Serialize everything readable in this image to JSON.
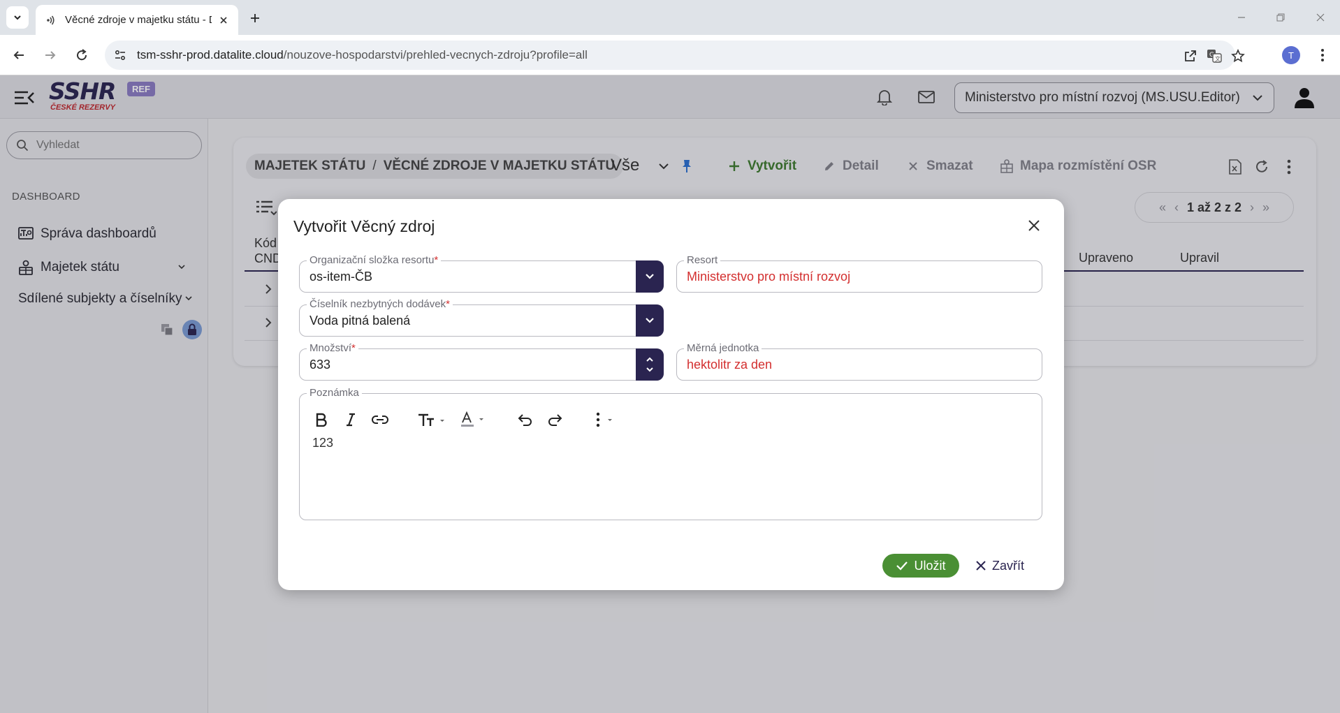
{
  "browser": {
    "tab_title": "Věcné zdroje v majetku státu - DataLite",
    "url_host": "tsm-sshr-prod.datalite.cloud",
    "url_path": "/nouzove-hospodarstvi/prehled-vecnych-zdroju?profile=all",
    "profile_initial": "T"
  },
  "header": {
    "logo_text": "SSHR",
    "logo_sub": "ČESKÉ REZERVY",
    "env_badge": "REF",
    "organization": "Ministerstvo pro místní rozvoj (MS.USU.Editor)"
  },
  "sidebar": {
    "search_placeholder": "Vyhledat",
    "section": "DASHBOARD",
    "items": [
      {
        "label": "Správa dashboardů",
        "icon": "dashboard-icon"
      },
      {
        "label": "Majetek státu",
        "icon": "property-icon"
      },
      {
        "label": "Sdílené subjekty a číselníky",
        "icon": ""
      }
    ]
  },
  "main": {
    "breadcrumb": [
      "MAJETEK STÁTU",
      "VĚCNÉ ZDROJE V MAJETKU STÁTU"
    ],
    "profile": "Vše",
    "toolbar": {
      "create": "Vytvořit",
      "detail": "Detail",
      "delete": "Smazat",
      "map": "Mapa rozmístění OSR"
    },
    "pager": "1 až 2 z 2",
    "columns": {
      "code_line1": "Kód",
      "code_line2": "CND",
      "modified": "Upraveno",
      "modified_by": "Upravil"
    }
  },
  "modal": {
    "title": "Vytvořit Věcný zdroj",
    "org_unit": {
      "label": "Organizační složka resortu",
      "value": "os-item-ČB"
    },
    "resort": {
      "label": "Resort",
      "value": "Ministerstvo pro místní rozvoj"
    },
    "catalog": {
      "label": "Číselník nezbytných dodávek",
      "value": "Voda pitná balená"
    },
    "quantity": {
      "label": "Množství",
      "value": "633"
    },
    "unit": {
      "label": "Měrná jednotka",
      "value": "hektolitr za den"
    },
    "note": {
      "label": "Poznámka",
      "value": "123"
    },
    "required_mark": "*",
    "save": "Uložit",
    "close": "Zavřít"
  },
  "colors": {
    "primary": "#2a2450",
    "success": "#4a8f34",
    "danger": "#d32f2f"
  }
}
